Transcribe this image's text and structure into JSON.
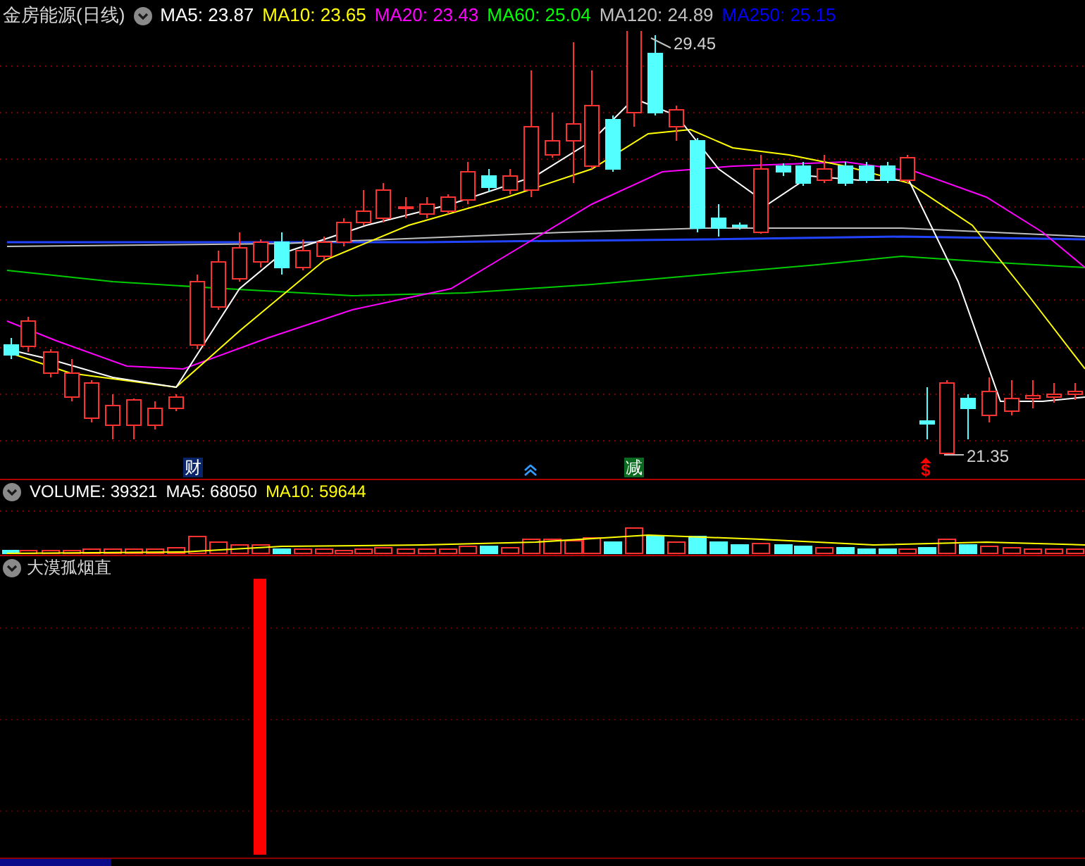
{
  "main_chart": {
    "title": "金房能源(日线)",
    "indicators": [
      {
        "label": "MA5: 23.87",
        "color": "#ffffff"
      },
      {
        "label": "MA10: 23.65",
        "color": "#ffff00"
      },
      {
        "label": "MA20: 23.43",
        "color": "#ff00ff"
      },
      {
        "label": "MA60: 25.04",
        "color": "#00ff00"
      },
      {
        "label": "MA120: 24.89",
        "color": "#c0c0c0"
      },
      {
        "label": "MA250: 25.15",
        "color": "#0000ff"
      }
    ],
    "high_label": "29.45",
    "low_label": "21.35",
    "markers": [
      {
        "kind": "badge",
        "text": "财",
        "color": "#0a246a"
      },
      {
        "kind": "arrow"
      },
      {
        "kind": "badge",
        "text": "减",
        "color": "#0a6a1f"
      },
      {
        "kind": "sign",
        "text": "$"
      }
    ]
  },
  "volume_pane": {
    "indicators": [
      {
        "label": "VOLUME: 39321",
        "color": "#ffffff"
      },
      {
        "label": "MA5: 68050",
        "color": "#ffffff"
      },
      {
        "label": "MA10: 59644",
        "color": "#ffff00"
      }
    ]
  },
  "indicator_pane": {
    "title": "大漠孤烟直"
  }
}
